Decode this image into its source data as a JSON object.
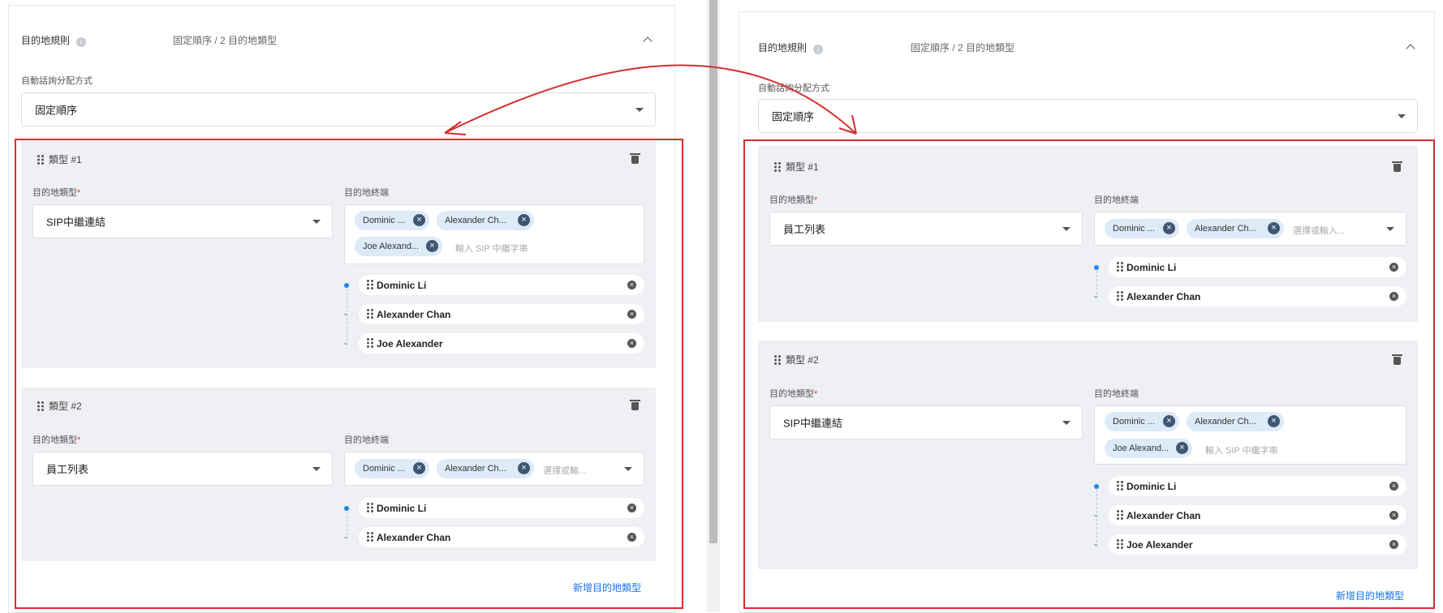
{
  "left": {
    "header_label": "目的地規則",
    "header_summary": "固定順序 / 2 目的地類型",
    "dist_label": "自動話詢分配方式",
    "dist_value": "固定順序",
    "groups": [
      {
        "title": "類型 #1",
        "type_label": "目的地類型",
        "type_value": "SIP中繼連結",
        "endpoint_label": "目的地終端",
        "chips": [
          "Dominic ...",
          "Alexander Ch...",
          "Joe Alexand..."
        ],
        "placeholder": "輸入 SIP 中繼字串",
        "destinations": [
          "Dominic Li",
          "Alexander Chan",
          "Joe Alexander"
        ]
      },
      {
        "title": "類型 #2",
        "type_label": "目的地類型",
        "type_value": "員工列表",
        "endpoint_label": "目的地終端",
        "chips": [
          "Dominic ...",
          "Alexander Ch..."
        ],
        "placeholder": "選擇或輸...",
        "destinations": [
          "Dominic Li",
          "Alexander Chan"
        ]
      }
    ],
    "add_link": "新增目的地類型"
  },
  "right": {
    "header_label": "目的地規則",
    "header_summary": "固定順序 / 2 目的地類型",
    "dist_label": "自動話詢分配方式",
    "dist_value": "固定順序",
    "groups": [
      {
        "title": "類型 #1",
        "type_label": "目的地類型",
        "type_value": "員工列表",
        "endpoint_label": "目的地終端",
        "chips": [
          "Dominic ...",
          "Alexander Ch..."
        ],
        "placeholder": "選擇或輸入...",
        "destinations": [
          "Dominic Li",
          "Alexander Chan"
        ]
      },
      {
        "title": "類型 #2",
        "type_label": "目的地類型",
        "type_value": "SIP中繼連結",
        "endpoint_label": "目的地終端",
        "chips": [
          "Dominic ...",
          "Alexander Ch...",
          "Joe Alexand..."
        ],
        "placeholder": "輸入 SIP 中繼字串",
        "destinations": [
          "Dominic Li",
          "Alexander Chan",
          "Joe Alexander"
        ]
      }
    ],
    "add_link": "新增目的地類型"
  },
  "colors": {
    "highlight_box": "#d32f2f",
    "chip_bg": "#ddeaf7",
    "group_bg": "#eef0f3",
    "link": "#1a73e8"
  },
  "icons": [
    "info-icon",
    "chevron-up-icon",
    "drag-handle-icon",
    "trash-icon",
    "chip-remove-icon",
    "remove-icon",
    "dropdown-caret-icon"
  ]
}
